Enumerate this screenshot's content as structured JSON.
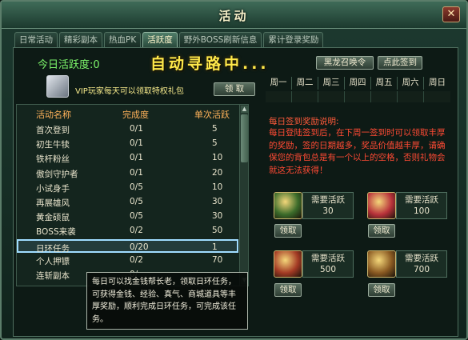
{
  "window": {
    "title": "活动",
    "close_glyph": "✕"
  },
  "tabs": [
    {
      "label": "日常活动",
      "active": false
    },
    {
      "label": "精彩副本",
      "active": false
    },
    {
      "label": "热血PK",
      "active": false
    },
    {
      "label": "活跃度",
      "active": true
    },
    {
      "label": "野外BOSS刷新信息",
      "active": false
    },
    {
      "label": "累计登录奖励",
      "active": false
    }
  ],
  "activity": {
    "score_text": "今日活跃度:0",
    "auto_path_text": "自动寻路中..."
  },
  "buttons": {
    "summon": "黑龙召唤令",
    "signin": "点此签到",
    "claim": "领 取"
  },
  "vip": {
    "text": "VIP玩家每天可以领取特权礼包",
    "icon": "vip-gift-icon"
  },
  "table": {
    "headers": [
      "活动名称",
      "完成度",
      "单次活跃"
    ],
    "rows": [
      {
        "name": "首次登到",
        "progress": "0/1",
        "points": "5"
      },
      {
        "name": "初生牛犊",
        "progress": "0/1",
        "points": "5"
      },
      {
        "name": "铁杆粉丝",
        "progress": "0/1",
        "points": "10"
      },
      {
        "name": "傲剑守护者",
        "progress": "0/1",
        "points": "20"
      },
      {
        "name": "小试身手",
        "progress": "0/5",
        "points": "10"
      },
      {
        "name": "再展雄风",
        "progress": "0/5",
        "points": "30"
      },
      {
        "name": "黄金硕鼠",
        "progress": "0/5",
        "points": "30"
      },
      {
        "name": "BOSS来袭",
        "progress": "0/2",
        "points": "50"
      },
      {
        "name": "日环任务",
        "progress": "0/20",
        "points": "1",
        "selected": true
      },
      {
        "name": "个人押镖",
        "progress": "0/2",
        "points": "70"
      },
      {
        "name": "连斩副本",
        "progress": "0/",
        "points": ""
      }
    ]
  },
  "tooltip": {
    "text": "每日可以找金钱帮长老，领取日环任务，可获得金钱、经验、真气、商城道具等丰厚奖励，顺利完成日环任务，可完成该任务。"
  },
  "week": {
    "days": [
      "周一",
      "周二",
      "周三",
      "周四",
      "周五",
      "周六",
      "周日"
    ]
  },
  "signin": {
    "title": "每日签到奖励说明:",
    "description": "每日登陆签到后，在下周一签到时可以领取丰厚的奖励，签的日期越多，奖品价值越丰厚，请确保您的背包总是有一个以上的空格，否则礼物会就这无法获得！"
  },
  "rewards": [
    {
      "requirement_label": "需要活跃",
      "value": "30",
      "claim": "领取",
      "icon": "treasure-chest-icon",
      "color": "#3b6b2a"
    },
    {
      "requirement_label": "需要活跃",
      "value": "100",
      "claim": "领取",
      "icon": "gift-box-icon",
      "color": "#b8323a"
    },
    {
      "requirement_label": "需要活跃",
      "value": "500",
      "claim": "领取",
      "icon": "red-chest-icon",
      "color": "#a33a24"
    },
    {
      "requirement_label": "需要活跃",
      "value": "700",
      "claim": "领取",
      "icon": "golden-chest-icon",
      "color": "#8a5a22"
    }
  ]
}
